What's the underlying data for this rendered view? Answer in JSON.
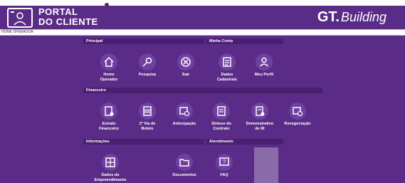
{
  "header": {
    "portal_line1": "PORTAL",
    "portal_line2": "DO CLIENTE",
    "brand_mark": "GT.",
    "brand_name": "Building"
  },
  "breadcrumb": "HOME OPERADOR",
  "sections": {
    "principal": "Principal",
    "minha_conta": "Minha Conta",
    "financeiro": "Financeiro",
    "informacoes": "Informações",
    "atendimento": "Atendimento"
  },
  "tiles": {
    "home_operador": "Home\nOperador",
    "pesquisa": "Pesquisa",
    "sair": "Sair",
    "dados_cadastrais": "Dados\nCadastrais",
    "meu_perfil": "Meu Perfil",
    "extrato": "Extrato\nFinanceiro",
    "segunda_via": "2ª Via de\nBoleto",
    "antecipacao": "Antecipação",
    "sintese": "Síntese do\nContrato",
    "demonstrativo": "Demonstrativo\nde IR",
    "renegociacao": "Renegociação",
    "dados_empreendimento": "Dados do\nEmpreendimento",
    "documentos": "Documentos",
    "faq": "FAQ"
  },
  "colors": {
    "background": "#5b2c87",
    "section_bar": "#4a1f72",
    "icon_circle": "#6f40a0"
  }
}
